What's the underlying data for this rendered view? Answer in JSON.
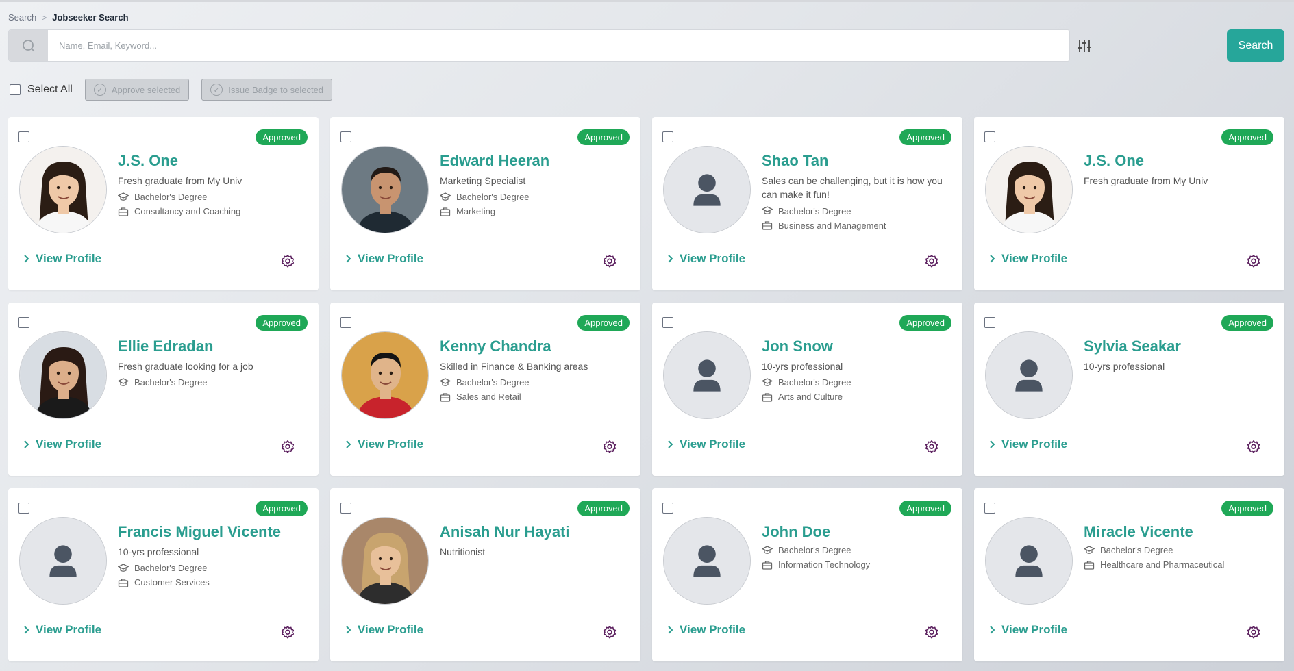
{
  "breadcrumb": {
    "parent": "Search",
    "separator": ">",
    "current": "Jobseeker Search"
  },
  "search": {
    "placeholder": "Name, Email, Keyword...",
    "value": "",
    "button_label": "Search"
  },
  "bulk": {
    "select_all_label": "Select All",
    "approve_label": "Approve selected",
    "badge_label": "Issue Badge to selected"
  },
  "colors": {
    "accent": "#26a69a",
    "name": "#2a9d8f",
    "approved": "#1fa857",
    "gear": "#5b1f5e"
  },
  "card_link_label": "View Profile",
  "cards": [
    {
      "name": "J.S. One",
      "headline": "Fresh graduate from My Univ",
      "degree": "Bachelor's Degree",
      "industry": "Consultancy and Coaching",
      "status": "Approved",
      "avatar": "photo-woman-1"
    },
    {
      "name": "Edward Heeran",
      "headline": "Marketing Specialist",
      "degree": "Bachelor's Degree",
      "industry": "Marketing",
      "status": "Approved",
      "avatar": "photo-man-1"
    },
    {
      "name": "Shao Tan",
      "headline": "Sales can be challenging, but it is how you can make it fun!",
      "degree": "Bachelor's Degree",
      "industry": "Business and Management",
      "status": "Approved",
      "avatar": "placeholder"
    },
    {
      "name": "J.S. One",
      "headline": "Fresh graduate from My Univ",
      "degree": "",
      "industry": "",
      "status": "Approved",
      "avatar": "photo-woman-1"
    },
    {
      "name": "Ellie Edradan",
      "headline": "Fresh graduate looking for a job",
      "degree": "Bachelor's Degree",
      "industry": "",
      "status": "Approved",
      "avatar": "photo-woman-2"
    },
    {
      "name": "Kenny Chandra",
      "headline": "Skilled in Finance & Banking areas",
      "degree": "Bachelor's Degree",
      "industry": "Sales and Retail",
      "status": "Approved",
      "avatar": "photo-man-2"
    },
    {
      "name": "Jon Snow",
      "headline": "10-yrs professional",
      "degree": "Bachelor's Degree",
      "industry": "Arts and Culture",
      "status": "Approved",
      "avatar": "placeholder"
    },
    {
      "name": "Sylvia Seakar",
      "headline": "10-yrs professional",
      "degree": "",
      "industry": "",
      "status": "Approved",
      "avatar": "placeholder"
    },
    {
      "name": "Francis Miguel Vicente",
      "headline": "10-yrs professional",
      "degree": "Bachelor's Degree",
      "industry": "Customer Services",
      "status": "Approved",
      "avatar": "placeholder"
    },
    {
      "name": "Anisah Nur Hayati",
      "headline": "Nutritionist",
      "degree": "",
      "industry": "",
      "status": "Approved",
      "avatar": "photo-woman-3"
    },
    {
      "name": "John Doe",
      "headline": "",
      "degree": "Bachelor's Degree",
      "industry": "Information Technology",
      "status": "Approved",
      "avatar": "placeholder"
    },
    {
      "name": "Miracle Vicente",
      "headline": "",
      "degree": "Bachelor's Degree",
      "industry": "Healthcare and Pharmaceutical",
      "status": "Approved",
      "avatar": "placeholder"
    }
  ]
}
